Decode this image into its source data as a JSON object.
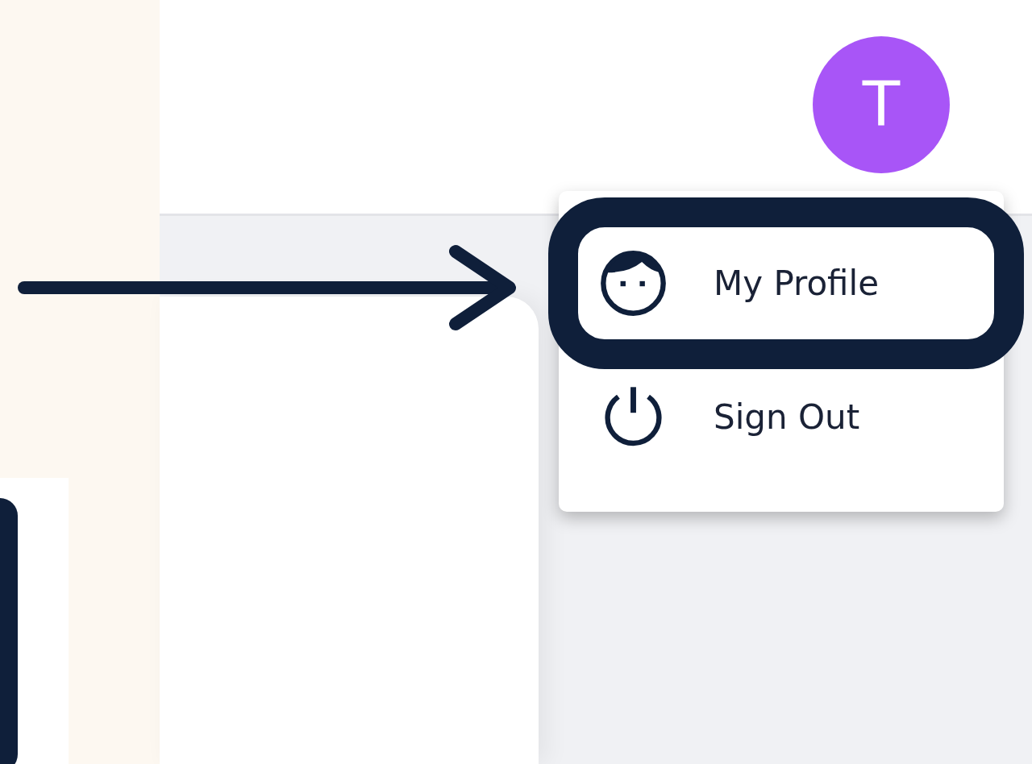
{
  "avatar": {
    "initial": "T"
  },
  "menu": {
    "items": [
      {
        "kind": "profile",
        "label": "My Profile",
        "highlighted": true
      },
      {
        "kind": "signout",
        "label": "Sign Out",
        "highlighted": false
      }
    ]
  }
}
